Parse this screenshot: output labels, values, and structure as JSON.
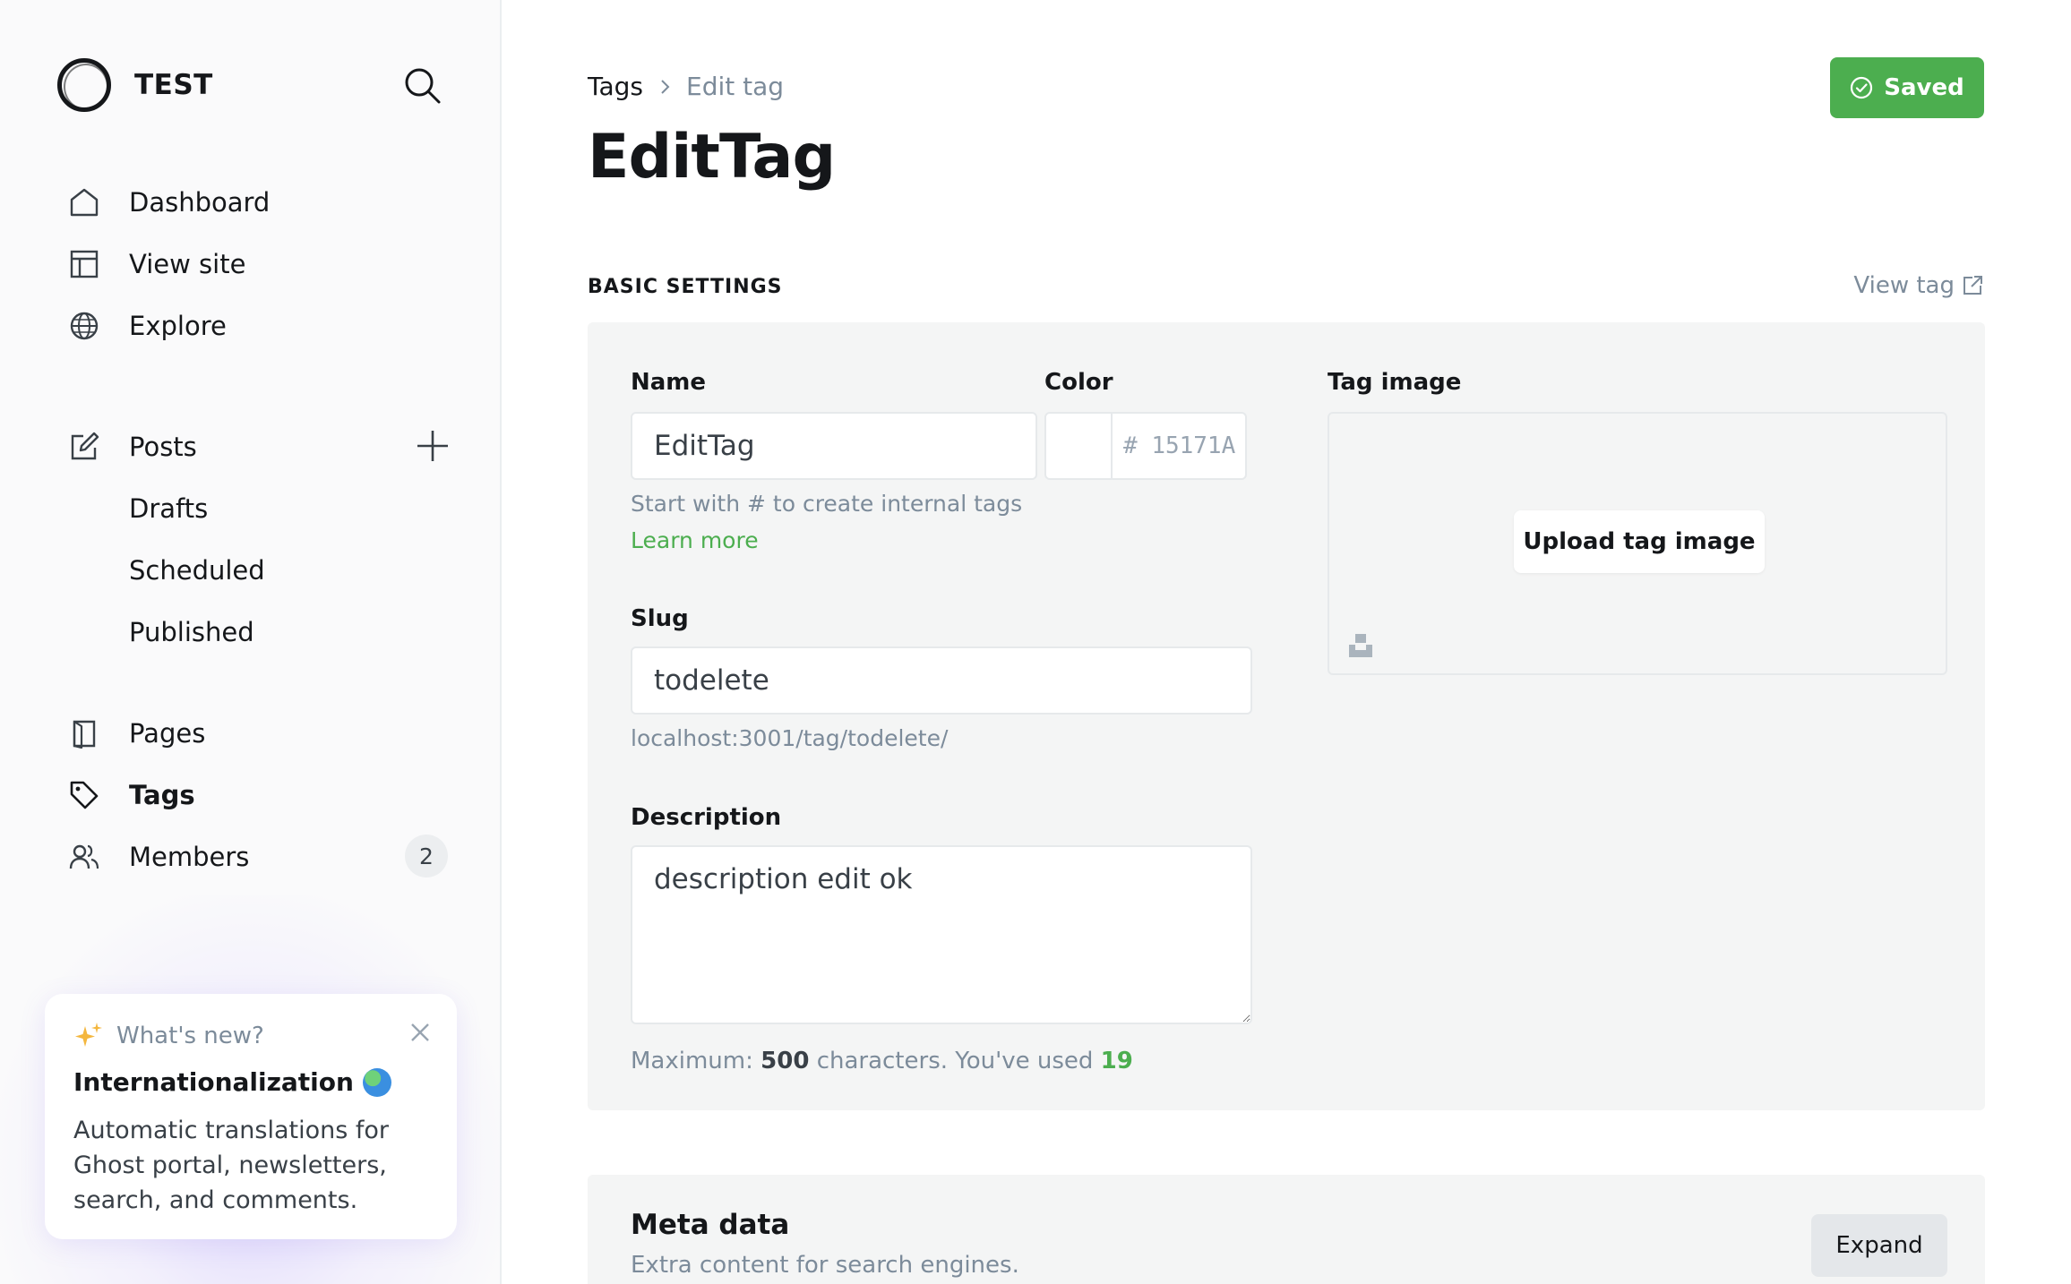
{
  "brand": {
    "name": "TEST"
  },
  "nav": {
    "dashboard": "Dashboard",
    "view_site": "View site",
    "explore": "Explore",
    "posts": "Posts",
    "drafts": "Drafts",
    "scheduled": "Scheduled",
    "published": "Published",
    "pages": "Pages",
    "tags": "Tags",
    "members": "Members",
    "members_count": "2"
  },
  "whats_new": {
    "heading": "What's new?",
    "title": "Internationalization",
    "body": "Automatic translations for Ghost portal, newsletters, search, and comments."
  },
  "breadcrumb": {
    "root": "Tags",
    "current": "Edit tag"
  },
  "page_title": "EditTag",
  "saved_button": "Saved",
  "section_title": "BASIC SETTINGS",
  "view_tag": "View tag",
  "form": {
    "name_label": "Name",
    "name_value": "EditTag",
    "name_hint": "Start with # to create internal tags",
    "learn_more": "Learn more",
    "color_label": "Color",
    "color_prefix": "#",
    "color_placeholder": "15171A",
    "image_label": "Tag image",
    "upload_button": "Upload tag image",
    "slug_label": "Slug",
    "slug_value": "todelete",
    "slug_url": "localhost:3001/tag/todelete/",
    "description_label": "Description",
    "description_value": "description edit ok",
    "counter_prefix": "Maximum:",
    "counter_max": "500",
    "counter_middle": "characters. You've used",
    "counter_used": "19"
  },
  "meta": {
    "title": "Meta data",
    "subtitle": "Extra content for search engines.",
    "expand_button": "Expand"
  },
  "colors": {
    "accent": "#4cae4f",
    "text": "#15171a",
    "muted": "#7c8b9a",
    "panel": "#f4f5f5"
  }
}
